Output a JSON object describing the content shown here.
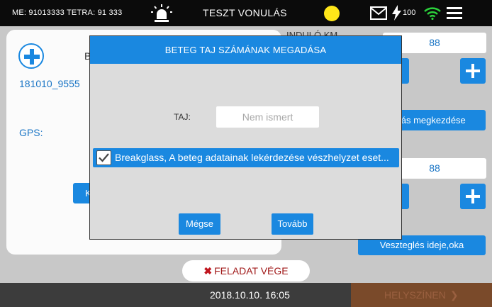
{
  "status_bar": {
    "me_tetra": "ME:  91013333  TETRA:  91 333",
    "title": "TESZT VONULÁS",
    "battery": "100",
    "icons": [
      "siren-icon",
      "status-dot-icon",
      "mail-icon",
      "bolt-icon",
      "wifi-icon",
      "menu-icon"
    ],
    "status_dot_color": "#ffe619"
  },
  "panel": {
    "b_label": "B",
    "case_id": "181010_9555",
    "gps_label": "GPS:",
    "k_button": "K"
  },
  "right": {
    "indulo_km_label": "INDULÓ KM",
    "km_start_value": "88",
    "start_button": "Vonulás megkezdése",
    "km_mid_value": "88",
    "halt_button": "Veszteglés ideje,oka"
  },
  "finish_button": "FELADAT VÉGE",
  "bottom": {
    "datetime": "2018.10.10.  16:05",
    "onsite_button": "HELYSZÍNEN"
  },
  "modal": {
    "title": "BETEG TAJ SZÁMÁNAK MEGADÁSA",
    "taj_label": "TAJ:",
    "taj_placeholder": "Nem ismert",
    "taj_value": "",
    "breakglass_checked": true,
    "breakglass_text": "Breakglass, A beteg adatainak lekérdezése vészhelyzet eset...",
    "cancel_button": "Mégse",
    "next_button": "Tovább"
  },
  "colors": {
    "accent": "#1a88e0",
    "finish_red": "#c0141d",
    "onsite_disabled": "#7a4a2a"
  }
}
